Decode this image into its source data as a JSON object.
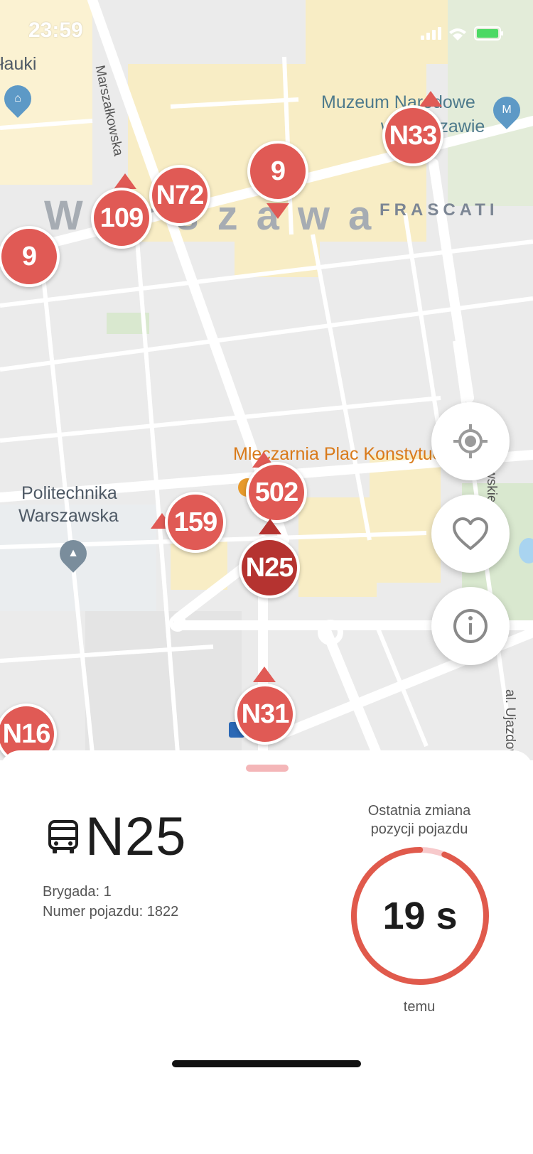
{
  "status_bar": {
    "time": "23:59"
  },
  "map": {
    "labels": {
      "lazienki_fragment": "łauki",
      "muzeum_line1": "Muzeum Narodowe",
      "muzeum_line2": "w Warszawie",
      "city": "Warszawa",
      "frascati": "FRASCATI",
      "marszalkowska": "Marszałkowska",
      "plac": "Mleczarnia Plac Konstytucji",
      "politechnika_line1": "Politechnika",
      "politechnika_line2": "Warszawska",
      "ujazdowskie": "al. Ujazdowskie",
      "partial_street": "wskie"
    },
    "markers": [
      {
        "label": "N33",
        "selected": false
      },
      {
        "label": "9",
        "selected": false
      },
      {
        "label": "N72",
        "selected": false
      },
      {
        "label": "109",
        "selected": false
      },
      {
        "label": "9",
        "selected": false
      },
      {
        "label": "502",
        "selected": false
      },
      {
        "label": "159",
        "selected": false
      },
      {
        "label": "N25",
        "selected": true
      },
      {
        "label": "N31",
        "selected": false
      },
      {
        "label": "N16",
        "selected": false
      }
    ],
    "controls": [
      "locate-icon",
      "heart-icon",
      "info-icon"
    ]
  },
  "vehicle": {
    "icon": "bus-icon",
    "route": "N25",
    "brigade": "Brygada: 1",
    "vehicle_number": "Numer pojazdu: 1822"
  },
  "last_change": {
    "caption_line1": "Ostatnia zmiana",
    "caption_line2": "pozycji pojazdu",
    "value": "19 s",
    "suffix": "temu",
    "ring_progress": 0.94
  },
  "colors": {
    "marker": "#e05a55",
    "marker_selected": "#b53330",
    "ring_track": "#f7c9cb",
    "ring_progress": "#e05a4c"
  }
}
